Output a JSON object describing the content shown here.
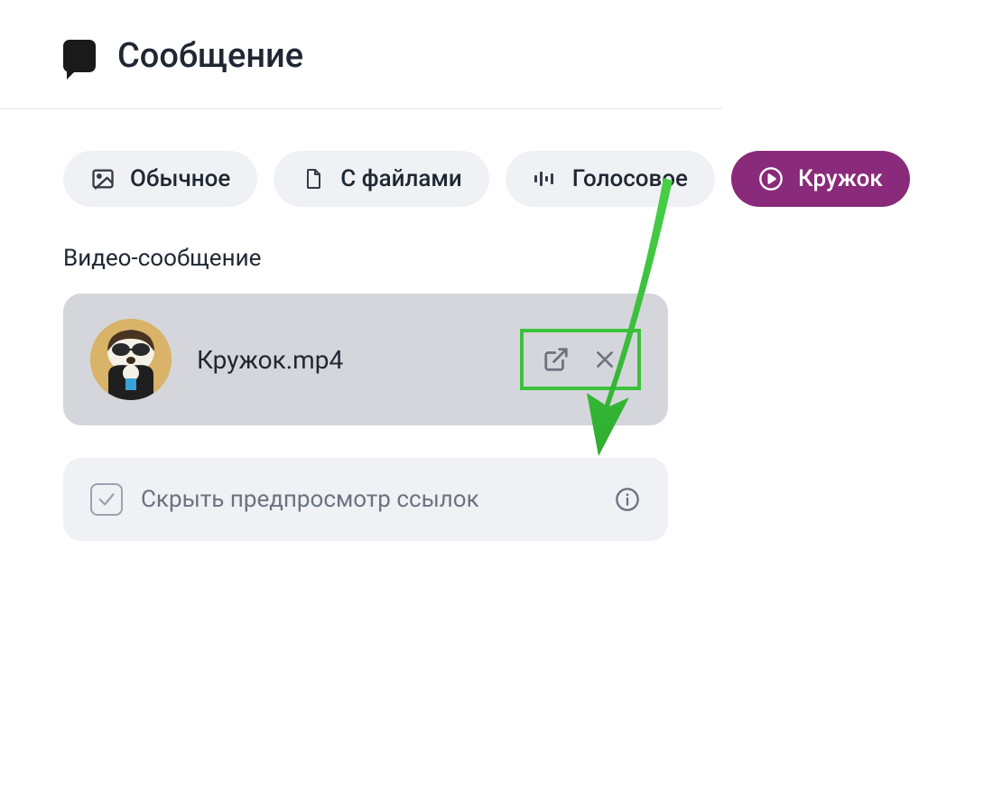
{
  "header": {
    "title": "Сообщение"
  },
  "pills": {
    "regular": "Обычное",
    "files": "С файлами",
    "voice": "Голосовое",
    "circle": "Кружок"
  },
  "section": {
    "videoMessageLabel": "Видео-сообщение"
  },
  "file": {
    "name": "Кружок.mp4"
  },
  "option": {
    "hidePreviewLabel": "Скрыть предпросмотр ссылок"
  },
  "annotations": {
    "arrowColor": "#3ac23a",
    "highlightColor": "#3ac23a"
  }
}
